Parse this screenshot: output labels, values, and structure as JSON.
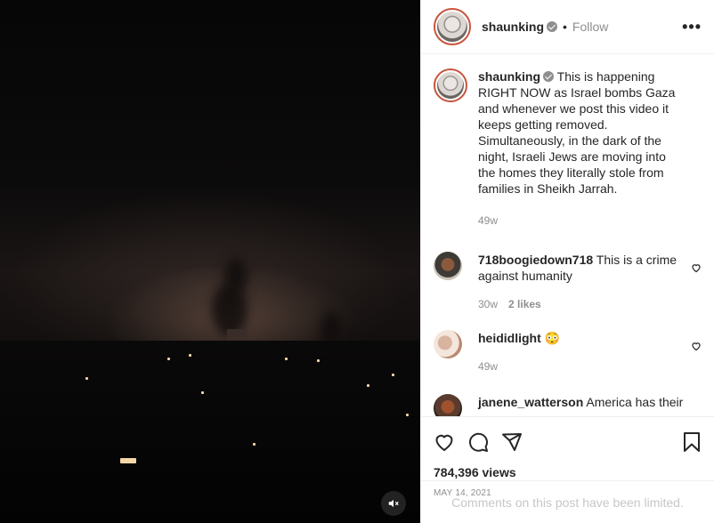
{
  "post": {
    "username": "shaunking",
    "follow_label": "Follow",
    "separator": "•",
    "more_label": "•••"
  },
  "caption": {
    "username": "shaunking",
    "text": "This is happening RIGHT NOW as Israel bombs Gaza and whenever we post this video it keeps getting removed. Simultaneously, in the dark of the night, Israeli Jews are moving into the homes they literally stole from families in Sheikh Jarrah.",
    "time": "49w"
  },
  "comments": [
    {
      "username": "718boogiedown718",
      "text": "This is a crime against humanity",
      "time": "30w",
      "likes": "2 likes"
    },
    {
      "username": "heididlight",
      "text": "😳",
      "time": "49w",
      "likes": ""
    },
    {
      "username": "janene_watterson",
      "text": "America has their",
      "time": "",
      "likes": ""
    }
  ],
  "stats": {
    "views": "784,396 views",
    "date": "MAY 14, 2021",
    "comments_limited": "Comments on this post have been limited."
  },
  "icons": {
    "like": "heart-icon",
    "comment": "comment-icon",
    "share": "share-icon",
    "save": "bookmark-icon",
    "mute": "muted-speaker-icon"
  },
  "colors": {
    "avatar_ring": "#c8553d",
    "muted_text": "#8e8e8e",
    "text": "#262626"
  }
}
